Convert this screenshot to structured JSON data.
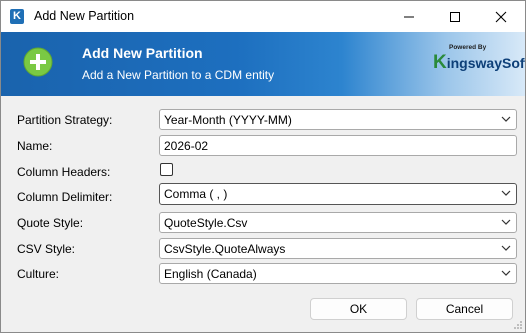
{
  "window": {
    "title": "Add New Partition"
  },
  "banner": {
    "title": "Add New Partition",
    "subtitle": "Add a New Partition to a CDM entity",
    "logo_small": "Powered By",
    "logo_k": "K",
    "logo_rest": "ingswaySoft"
  },
  "form": {
    "partition_strategy": {
      "label": "Partition Strategy:",
      "value": "Year-Month (YYYY-MM)"
    },
    "name": {
      "label": "Name:",
      "value": "2026-02"
    },
    "column_headers": {
      "label": "Column Headers:",
      "checked": false
    },
    "column_delimiter": {
      "label": "Column Delimiter:",
      "value": "Comma ( , )"
    },
    "quote_style": {
      "label": "Quote Style:",
      "value": "QuoteStyle.Csv"
    },
    "csv_style": {
      "label": "CSV Style:",
      "value": "CsvStyle.QuoteAlways"
    },
    "culture": {
      "label": "Culture:",
      "value": "English (Canada)"
    }
  },
  "buttons": {
    "ok": "OK",
    "cancel": "Cancel"
  },
  "colors": {
    "banner": "#1d6fbf",
    "accent_green": "#7ac943"
  }
}
